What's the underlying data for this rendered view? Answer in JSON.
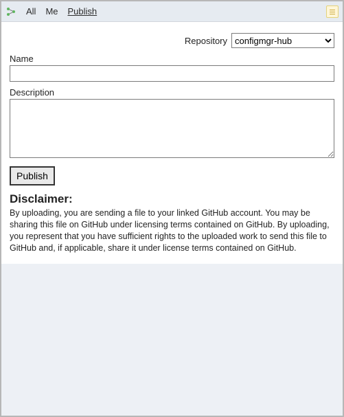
{
  "toolbar": {
    "tabs": [
      {
        "label": "All"
      },
      {
        "label": "Me"
      },
      {
        "label": "Publish"
      }
    ],
    "active_index": 2
  },
  "form": {
    "repository_label": "Repository",
    "repository_selected": "configmgr-hub",
    "repository_options": [
      "configmgr-hub"
    ],
    "name_label": "Name",
    "name_value": "",
    "description_label": "Description",
    "description_value": "",
    "publish_button": "Publish"
  },
  "disclaimer": {
    "heading": "Disclaimer:",
    "text": "By uploading, you are sending a file to your linked GitHub account. You may be sharing this file on GitHub under licensing terms contained on GitHub. By uploading, you represent that you have sufficient rights to the uploaded work to send this file to GitHub and, if applicable, share it under license terms contained on GitHub."
  }
}
